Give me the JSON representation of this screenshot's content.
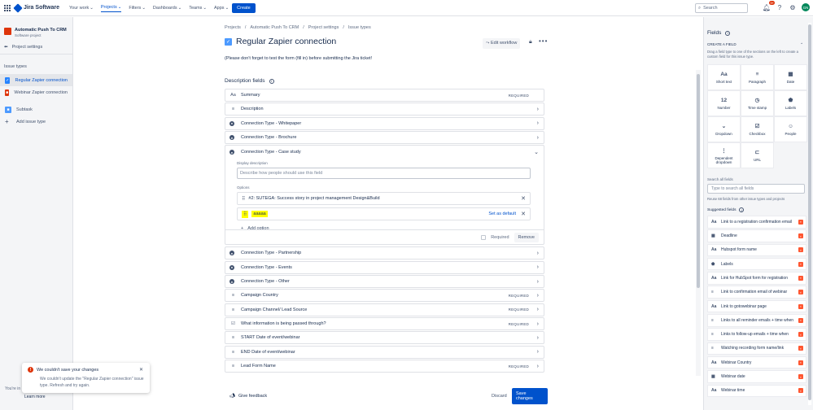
{
  "topbar": {
    "logo": "Jira Software",
    "nav": [
      "Your work",
      "Projects",
      "Filters",
      "Dashboards",
      "Teams",
      "Apps"
    ],
    "create_label": "Create",
    "search_placeholder": "Search",
    "notification_count": "9+",
    "avatar_initials": "GN"
  },
  "sidebar": {
    "project_name": "Automatic Push To CRM",
    "project_type": "Software project",
    "project_settings": "Project settings",
    "issue_types_header": "Issue types",
    "items": [
      {
        "label": "Regular Zapier connection",
        "color": "#2684ff"
      },
      {
        "label": "Webinar Zapier connection",
        "color": "#de350b"
      },
      {
        "label": "Subtask",
        "color": "#4c9aff"
      },
      {
        "label": "Add issue type",
        "color": ""
      }
    ]
  },
  "toast": {
    "title": "We couldn't save your changes",
    "body": "We couldn't update the \"Regular Zapier connection\" issue type. Refresh and try again.",
    "youre": "You're in",
    "learn_more": "Learn more"
  },
  "main": {
    "breadcrumbs": [
      "Projects",
      "Automatic Push To CRM",
      "Project settings",
      "Issue types"
    ],
    "title": "Regular Zapier connection",
    "edit_workflow": "Edit workflow",
    "note": "(Please don't forget to test the form (fill in) before submitting the Jira ticket!",
    "desc_fields_header": "Description fields",
    "fields_top": [
      {
        "icon": "Aa",
        "label": "Summary",
        "required": "REQUIRED",
        "chev": ""
      },
      {
        "icon": "≡",
        "label": "Description",
        "required": "",
        "chev": "›"
      },
      {
        "icon": "●",
        "label": "Connection Type - Whitepaper",
        "required": "",
        "chev": "›"
      },
      {
        "icon": "●",
        "label": "Connection Type - Brochure",
        "required": "",
        "chev": "›"
      }
    ],
    "expanded": {
      "label": "Connection Type - Case study",
      "display_desc_label": "Display description",
      "display_desc_placeholder": "Describe how people should use this field",
      "options_label": "Options",
      "option1": "#2: SUTEGA: Success story in project management Design&Build",
      "option2": "aaaaa",
      "set_default": "Set as default",
      "add_option": "Add option",
      "required_label": "Required",
      "remove_label": "Remove"
    },
    "fields_bottom": [
      {
        "icon": "●",
        "label": "Connection Type - Partnership",
        "required": "",
        "chev": "›"
      },
      {
        "icon": "●",
        "label": "Connection Type - Events",
        "required": "",
        "chev": "›"
      },
      {
        "icon": "●",
        "label": "Connection Type - Other",
        "required": "",
        "chev": "›"
      },
      {
        "icon": "≡",
        "label": "Campaign Country",
        "required": "REQUIRED",
        "chev": "›"
      },
      {
        "icon": "≡",
        "label": "Campaign Channel/ Lead Source",
        "required": "REQUIRED",
        "chev": "›"
      },
      {
        "icon": "☑",
        "label": "What information is being passed through?",
        "required": "REQUIRED",
        "chev": "›"
      },
      {
        "icon": "≡",
        "label": "START Date of event/webinar",
        "required": "",
        "chev": "›"
      },
      {
        "icon": "≡",
        "label": "END Date of event/webinar",
        "required": "",
        "chev": "›"
      },
      {
        "icon": "≡",
        "label": "Lead Form Name",
        "required": "REQUIRED",
        "chev": "›"
      }
    ],
    "give_feedback": "Give feedback",
    "discard": "Discard",
    "save": "Save changes"
  },
  "right_panel": {
    "title": "Fields",
    "create_field": "CREATE A FIELD",
    "hint": "Drag a field type to one of the sections on the left to create a custom field for this issue type.",
    "tiles": [
      {
        "icon": "Aa",
        "label": "Short text"
      },
      {
        "icon": "≡",
        "label": "Paragraph"
      },
      {
        "icon": "▦",
        "label": "Date"
      },
      {
        "icon": "12",
        "label": "Number"
      },
      {
        "icon": "◷",
        "label": "Time stamp"
      },
      {
        "icon": "⬟",
        "label": "Labels"
      },
      {
        "icon": "⌄",
        "label": "Dropdown"
      },
      {
        "icon": "☑",
        "label": "Checkbox"
      },
      {
        "icon": "☺",
        "label": "People"
      },
      {
        "icon": "⋮",
        "label": "Dependent dropdown"
      },
      {
        "icon": "⊏",
        "label": "URL"
      }
    ],
    "search_label": "Search all fields",
    "search_placeholder": "Type to search all fields",
    "reuse": "Reuse 68 fields from other issue types and projects",
    "suggested": "Suggested fields",
    "suggested_fields": [
      {
        "icon": "Aa",
        "label": "Link to a registration confirmation email"
      },
      {
        "icon": "▦",
        "label": "Deadline"
      },
      {
        "icon": "Aa",
        "label": "Hubspot form name"
      },
      {
        "icon": "⬟",
        "label": "Labels"
      },
      {
        "icon": "Aa",
        "label": "Link for HubSpot form for registration"
      },
      {
        "icon": "≡",
        "label": "Link to confirmation email of webinar"
      },
      {
        "icon": "Aa",
        "label": "Link to gotowebinar page"
      },
      {
        "icon": "≡",
        "label": "Links to all reminder emails + time when"
      },
      {
        "icon": "≡",
        "label": "Links to follow-up emails + time when"
      },
      {
        "icon": "≡",
        "label": "Watching recording form name/link"
      },
      {
        "icon": "Aa",
        "label": "Webinar Country"
      },
      {
        "icon": "▦",
        "label": "Webinar date"
      },
      {
        "icon": "Aa",
        "label": "Webinar time"
      }
    ]
  }
}
